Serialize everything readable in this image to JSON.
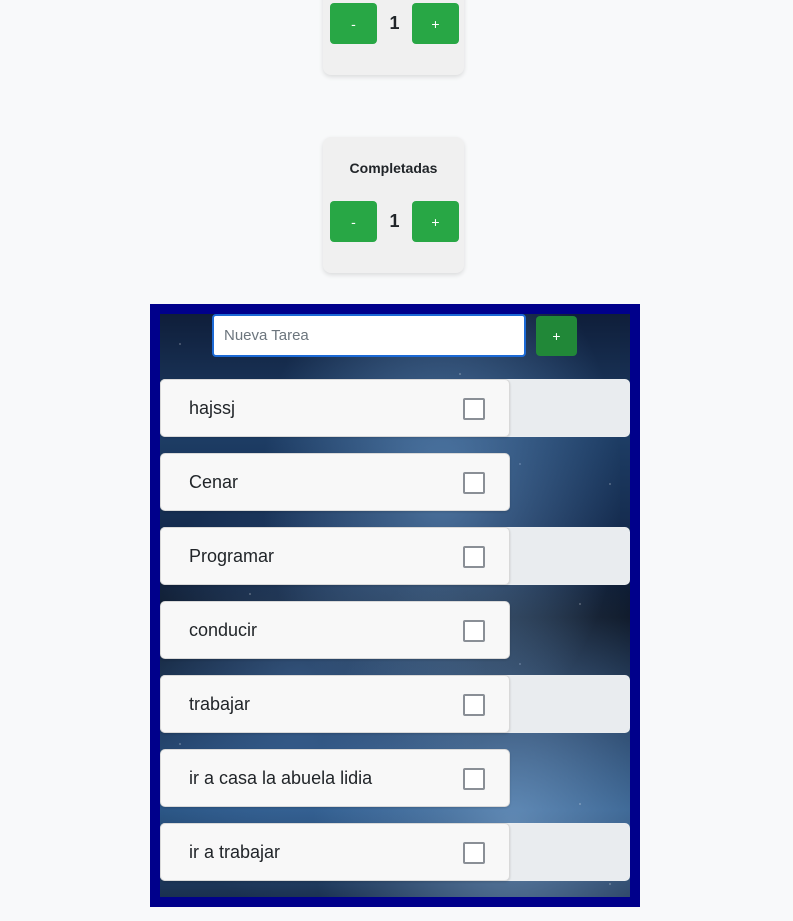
{
  "top_counter": {
    "decrement_label": "-",
    "value": "1",
    "increment_label": "+"
  },
  "completed_counter": {
    "title": "Completadas",
    "decrement_label": "-",
    "value": "1",
    "increment_label": "+"
  },
  "new_task": {
    "placeholder": "Nueva Tarea",
    "value": "",
    "add_label": "+"
  },
  "tasks": [
    {
      "text": "hajssj",
      "checked": false
    },
    {
      "text": "Cenar",
      "checked": false
    },
    {
      "text": "Programar",
      "checked": false
    },
    {
      "text": "conducir",
      "checked": false
    },
    {
      "text": "trabajar",
      "checked": false
    },
    {
      "text": "ir a casa la abuela lidia",
      "checked": false
    },
    {
      "text": "ir a trabajar",
      "checked": false
    }
  ],
  "colors": {
    "button_green": "#28a745",
    "panel_border": "#00008b",
    "input_focus_border": "#1c6ad6"
  }
}
